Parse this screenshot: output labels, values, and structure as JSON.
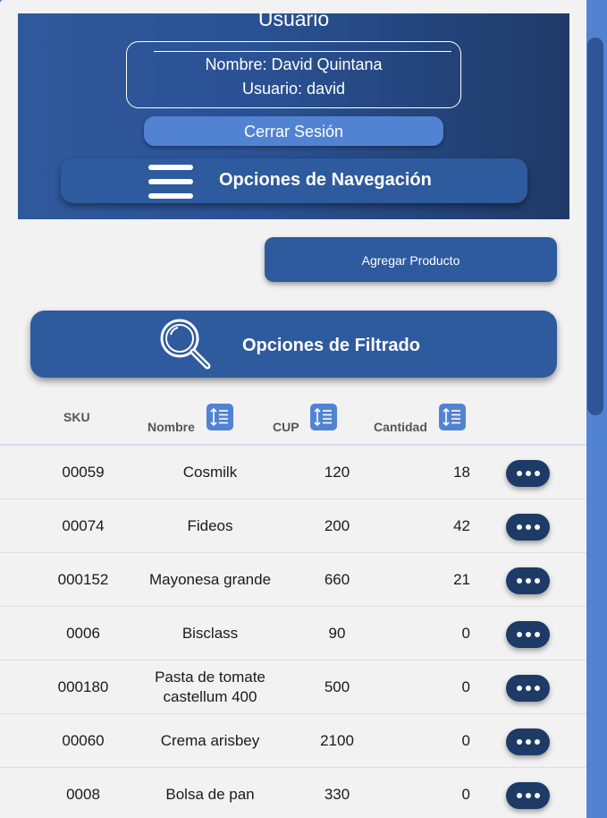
{
  "header": {
    "title": "Usuario",
    "user_name": "Nombre: David Quintana",
    "user_login": "Usuario: david",
    "logout_label": "Cerrar Sesión",
    "nav_label": "Opciones de Navegación"
  },
  "actions": {
    "add_product_label": "Agregar Producto",
    "filter_label": "Opciones de Filtrado"
  },
  "table": {
    "columns": [
      "SKU",
      "Nombre",
      "CUP",
      "Cantidad"
    ],
    "rows": [
      {
        "sku": "00059",
        "name": "Cosmilk",
        "cup": "120",
        "qty": "18"
      },
      {
        "sku": "00074",
        "name": "Fideos",
        "cup": "200",
        "qty": "42"
      },
      {
        "sku": "000152",
        "name": "Mayonesa grande",
        "cup": "660",
        "qty": "21"
      },
      {
        "sku": "0006",
        "name": "Bisclass",
        "cup": "90",
        "qty": "0"
      },
      {
        "sku": "000180",
        "name": "Pasta de tomate castellum 400",
        "cup": "500",
        "qty": "0"
      },
      {
        "sku": "00060",
        "name": "Crema arisbey",
        "cup": "2100",
        "qty": "0"
      },
      {
        "sku": "0008",
        "name": "Bolsa de pan",
        "cup": "330",
        "qty": "0"
      }
    ]
  },
  "icons": {
    "menu": "hamburger-icon",
    "search": "magnifier-icon",
    "sort": "sort-icon",
    "more": "more-horizontal-icon"
  },
  "colors": {
    "header_start": "#30599c",
    "header_end": "#1f3a67",
    "accent": "#5283d2",
    "button": "#2e5a9e",
    "more_button": "#1e3a66",
    "background": "#f2f2f2"
  }
}
